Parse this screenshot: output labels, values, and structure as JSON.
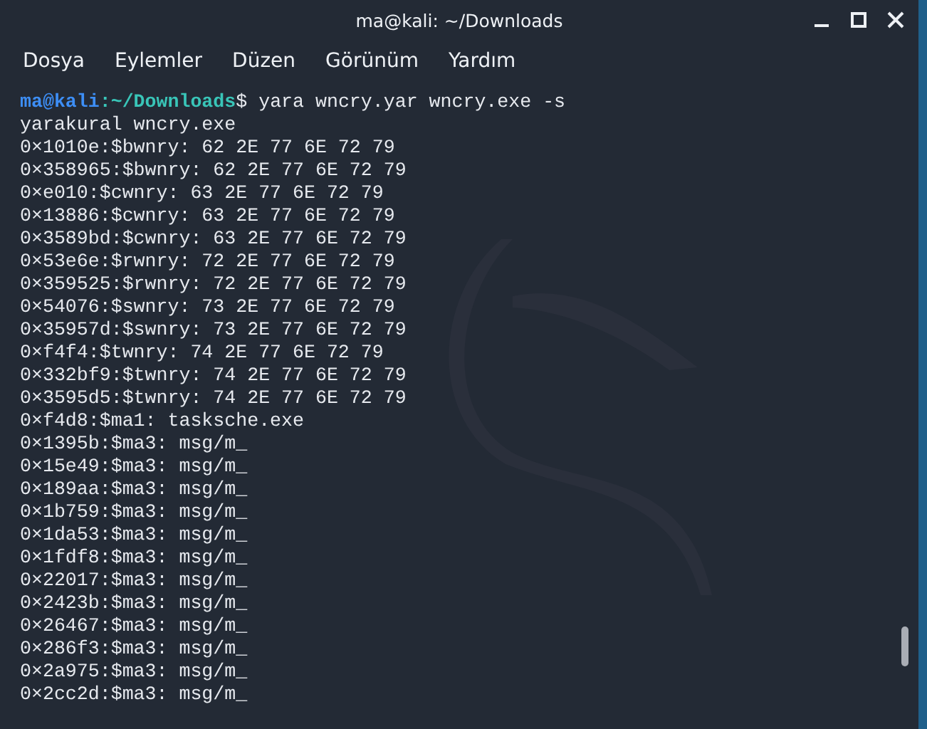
{
  "window": {
    "title": "ma@kali: ~/Downloads"
  },
  "menu": [
    "Dosya",
    "Eylemler",
    "Düzen",
    "Görünüm",
    "Yardım"
  ],
  "prompt": {
    "user_host": "ma@kali",
    "path": ":~/Downloads",
    "symbol": "$",
    "command": "yara wncry.yar wncry.exe -s"
  },
  "output": [
    "yarakural wncry.exe",
    "0×1010e:$bwnry: 62 2E 77 6E 72 79",
    "0×358965:$bwnry: 62 2E 77 6E 72 79",
    "0×e010:$cwnry: 63 2E 77 6E 72 79",
    "0×13886:$cwnry: 63 2E 77 6E 72 79",
    "0×3589bd:$cwnry: 63 2E 77 6E 72 79",
    "0×53e6e:$rwnry: 72 2E 77 6E 72 79",
    "0×359525:$rwnry: 72 2E 77 6E 72 79",
    "0×54076:$swnry: 73 2E 77 6E 72 79",
    "0×35957d:$swnry: 73 2E 77 6E 72 79",
    "0×f4f4:$twnry: 74 2E 77 6E 72 79",
    "0×332bf9:$twnry: 74 2E 77 6E 72 79",
    "0×3595d5:$twnry: 74 2E 77 6E 72 79",
    "0×f4d8:$ma1: tasksche.exe",
    "0×1395b:$ma3: msg/m_",
    "0×15e49:$ma3: msg/m_",
    "0×189aa:$ma3: msg/m_",
    "0×1b759:$ma3: msg/m_",
    "0×1da53:$ma3: msg/m_",
    "0×1fdf8:$ma3: msg/m_",
    "0×22017:$ma3: msg/m_",
    "0×2423b:$ma3: msg/m_",
    "0×26467:$ma3: msg/m_",
    "0×286f3:$ma3: msg/m_",
    "0×2a975:$ma3: msg/m_",
    "0×2cc2d:$ma3: msg/m_"
  ]
}
